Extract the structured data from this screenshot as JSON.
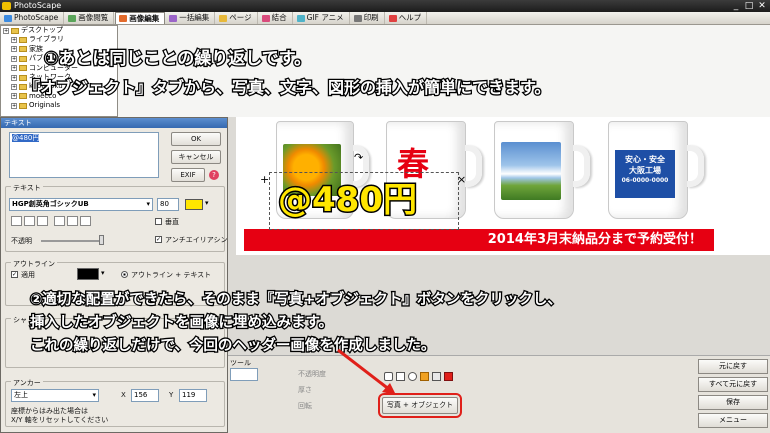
{
  "window": {
    "title": "PhotoScape",
    "controls": [
      "_",
      "□",
      "✕"
    ]
  },
  "tabs": [
    {
      "label": "PhotoScape",
      "color": "#3c8be0"
    },
    {
      "label": "画像閲覧",
      "color": "#5aa55a"
    },
    {
      "label": "画像編集",
      "color": "#e36b2c",
      "active": true
    },
    {
      "label": "一括編集",
      "color": "#9b64c8"
    },
    {
      "label": "ページ",
      "color": "#e8b93a"
    },
    {
      "label": "結合",
      "color": "#d94b7c"
    },
    {
      "label": "GIF アニメ",
      "color": "#4fb3c9"
    },
    {
      "label": "印刷",
      "color": "#777777"
    },
    {
      "label": "ヘルプ",
      "color": "#e04040"
    }
  ],
  "tree": [
    "デスクトップ",
    "ライブラリ",
    "家族",
    "パブリック",
    "コンピューター",
    "ネットワーク",
    "kyougoku",
    "moecco",
    "Originals"
  ],
  "photo": {
    "banner_text": "2014年3月末納品分まで予約受付！",
    "mug_text_1": "春",
    "mug_text_2_lines": [
      "安心・安全",
      "大阪工場",
      "06-0000-0000"
    ],
    "price_object": "@480円"
  },
  "text_dialog": {
    "title": "テキスト",
    "text_value": "@480円",
    "ok": "OK",
    "cancel": "キャンセル",
    "exif": "EXIF",
    "text_section": "テキスト",
    "font_name": "HGP創英角ゴシックUB",
    "font_size": "80",
    "vertical": "垂直",
    "opacity": "不透明",
    "antialias": "アンチエイリアシン",
    "outline_section": "アウトライン",
    "apply": "適用",
    "outline_mode": "アウトライン + テキスト",
    "shadow_section": "シャ",
    "anchor_section": "アンカー",
    "anchor_value": "左上",
    "x_label": "X",
    "x_value": "156",
    "y_label": "Y",
    "y_value": "119",
    "note_1": "座標からはみ出た場合は",
    "note_2": "X/Y 軸をリセットしてください"
  },
  "bottom": {
    "tool_tab": "ツール",
    "opacity": "不透明度",
    "thickness": "厚さ",
    "rotate": "回転",
    "photo_object_button": "写真 + オブジェクト"
  },
  "right_buttons": [
    "元に戻す",
    "すべて元に戻す",
    "保存",
    "メニュー"
  ],
  "annotations": {
    "line1": "①あとは同じことの繰り返しです。",
    "line2": "『オブジェクト』タブから、写真、文字、図形の挿入が簡単にできます。",
    "line3": "②適切な配置ができたら、そのまま『写真+オブジェクト』ボタンをクリックし、",
    "line4": "挿入したオブジェクトを画像に埋め込みます。",
    "line5": "これの繰り返しだけで、今回のヘッダー画像を作成しました。"
  },
  "colors": {
    "accent_red": "#e60012",
    "price_yellow": "#ffe600",
    "highlight_red": "#e0201a"
  }
}
